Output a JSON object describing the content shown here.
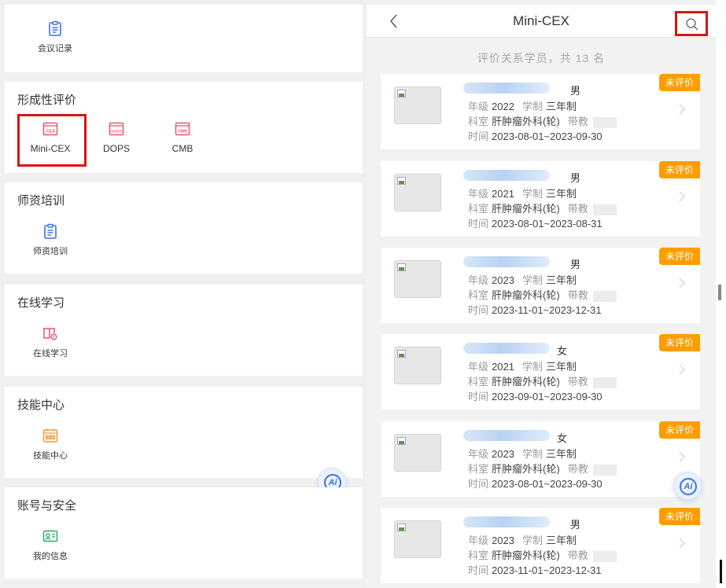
{
  "left": {
    "meeting": {
      "label": "会议记录"
    },
    "formative": {
      "title": "形成性评价",
      "items": [
        {
          "label": "Mini-CEX",
          "icon_text": "CEX"
        },
        {
          "label": "DOPS",
          "icon_text": "DOPS"
        },
        {
          "label": "CMB",
          "icon_text": "CMB"
        }
      ]
    },
    "faculty": {
      "title": "师资培训",
      "item_label": "师资培训"
    },
    "online": {
      "title": "在线学习",
      "item_label": "在线学习"
    },
    "skills": {
      "title": "技能中心",
      "item_label": "技能中心",
      "icon_text": "实训"
    },
    "account": {
      "title": "账号与安全",
      "item_label": "我的信息"
    },
    "ai_label": "Ai"
  },
  "right": {
    "title": "Mini-CEX",
    "summary": "评价关系学员，共 13 名",
    "labels": {
      "grade": "年级",
      "system": "学制",
      "dept": "科室",
      "teacher": "带教",
      "time": "时间"
    },
    "students": [
      {
        "gender": "男",
        "grade": "2022",
        "system": "三年制",
        "dept": "肝肿瘤外科(轮)",
        "time": "2023-08-01~2023-09-30",
        "status": "未评价"
      },
      {
        "gender": "男",
        "grade": "2021",
        "system": "三年制",
        "dept": "肝肿瘤外科(轮)",
        "time": "2023-08-01~2023-08-31",
        "status": "未评价"
      },
      {
        "gender": "男",
        "grade": "2023",
        "system": "三年制",
        "dept": "肝肿瘤外科(轮)",
        "time": "2023-11-01~2023-12-31",
        "status": "未评价"
      },
      {
        "gender": "女",
        "grade": "2021",
        "system": "三年制",
        "dept": "肝肿瘤外科(轮)",
        "time": "2023-09-01~2023-09-30",
        "status": "未评价"
      },
      {
        "gender": "女",
        "grade": "2023",
        "system": "三年制",
        "dept": "肝肿瘤外科(轮)",
        "time": "2023-08-01~2023-09-30",
        "status": "未评价"
      },
      {
        "gender": "男",
        "grade": "2023",
        "system": "三年制",
        "dept": "肝肿瘤外科(轮)",
        "time": "2023-11-01~2023-12-31",
        "status": "未评价"
      }
    ],
    "ai_label": "Ai"
  },
  "colors": {
    "eval_icon": "#f0506e",
    "accent_blue": "#3d6fe6",
    "badge": "#ff9d00",
    "highlight_box": "#d9140f"
  }
}
